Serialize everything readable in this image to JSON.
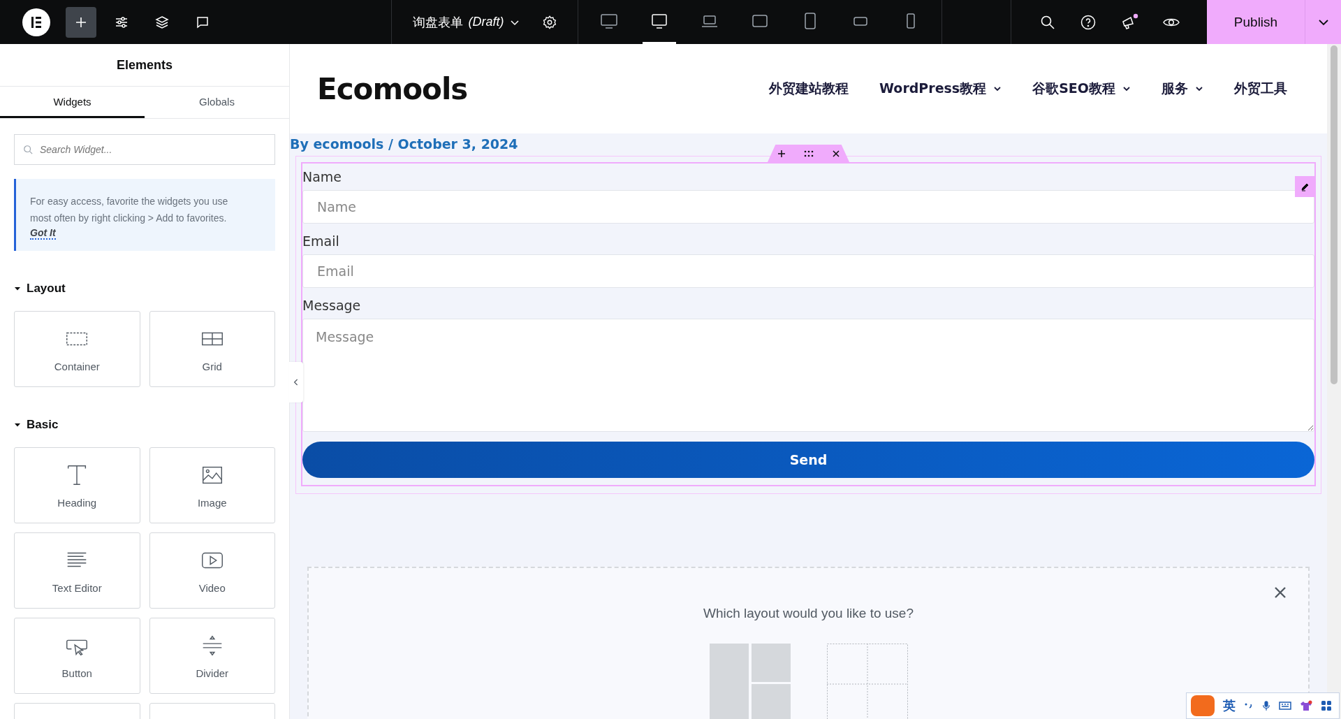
{
  "topbar": {
    "tools": [
      {
        "kind": "add",
        "selected": true
      },
      {
        "kind": "settings",
        "selected": false
      },
      {
        "kind": "structure",
        "selected": false
      },
      {
        "kind": "comments",
        "selected": false
      }
    ],
    "document": {
      "title": "询盘表单",
      "status": "(Draft)"
    },
    "devices": [
      {
        "kind": "desktop",
        "selected": false
      },
      {
        "kind": "widescreen",
        "selected": true
      },
      {
        "kind": "laptop",
        "selected": false
      },
      {
        "kind": "tablet-extra",
        "selected": false
      },
      {
        "kind": "tablet",
        "selected": false
      },
      {
        "kind": "mobile-extra",
        "selected": false
      },
      {
        "kind": "mobile",
        "selected": false
      }
    ],
    "publish": "Publish"
  },
  "panel": {
    "title": "Elements",
    "tabs": [
      {
        "label": "Widgets",
        "selected": true
      },
      {
        "label": "Globals",
        "selected": false
      }
    ],
    "search": {
      "placeholder": "Search Widget..."
    },
    "tip": {
      "text": "For easy access, favorite the widgets you use most often by right clicking > Add to favorites.",
      "link": "Got It"
    },
    "categories": [
      {
        "name": "Layout",
        "expanded": true,
        "widgets": [
          {
            "label": "Container",
            "kind": "container"
          },
          {
            "label": "Grid",
            "kind": "grid"
          }
        ]
      },
      {
        "name": "Basic",
        "expanded": true,
        "widgets": [
          {
            "label": "Heading",
            "kind": "heading"
          },
          {
            "label": "Image",
            "kind": "image"
          },
          {
            "label": "Text Editor",
            "kind": "text"
          },
          {
            "label": "Video",
            "kind": "video"
          },
          {
            "label": "Button",
            "kind": "button"
          },
          {
            "label": "Divider",
            "kind": "divider"
          }
        ]
      }
    ]
  },
  "site": {
    "logo": "Ecomools",
    "nav": [
      {
        "label": "外贸建站教程",
        "dropdown": false
      },
      {
        "label": "WordPress教程",
        "dropdown": true
      },
      {
        "label": "谷歌SEO教程",
        "dropdown": true
      },
      {
        "label": "服务",
        "dropdown": true
      },
      {
        "label": "外贸工具",
        "dropdown": false
      }
    ],
    "byline": "By ecomools / October 3, 2024",
    "form": {
      "fields": [
        {
          "label": "Name",
          "placeholder": "Name",
          "kind": "input"
        },
        {
          "label": "Email",
          "placeholder": "Email",
          "kind": "input"
        },
        {
          "label": "Message",
          "placeholder": "Message",
          "kind": "textarea"
        }
      ],
      "submit": "Send"
    },
    "layout_picker": {
      "question": "Which layout would you like to use?"
    }
  },
  "ime": {
    "mode": "英"
  }
}
